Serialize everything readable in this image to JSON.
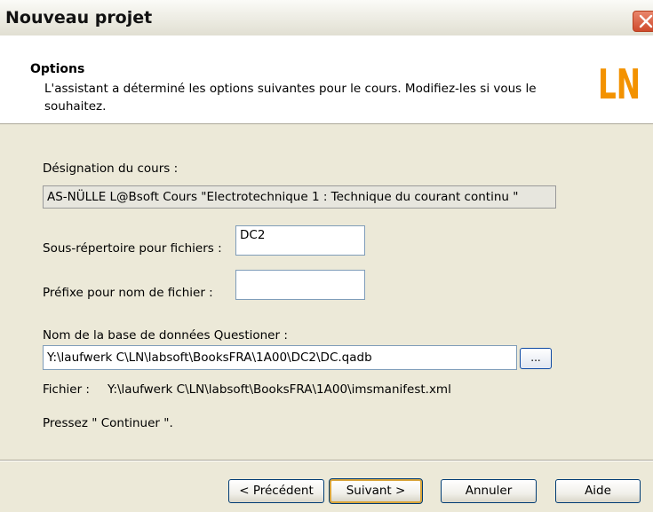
{
  "window": {
    "title": "Nouveau projet",
    "close_icon": "close-icon"
  },
  "header": {
    "title": "Options",
    "description": "L'assistant a déterminé les options suivantes pour le cours. Modifiez-les si vous le souhaitez.",
    "logo_text": "LN",
    "logo_color": "#f39200"
  },
  "form": {
    "course_label": "Désignation du cours :",
    "course_value": "AS-NÜLLE L@Bsoft Cours \"Electrotechnique 1 : Technique du courant continu \"",
    "subdir_label": "Sous-répertoire pour fichiers :",
    "subdir_value": "DC2",
    "prefix_label": "Préfixe pour nom de fichier :",
    "prefix_value": "",
    "db_label": "Nom de la base de données Questioner :",
    "db_value": "Y:\\laufwerk C\\LN\\labsoft\\BooksFRA\\1A00\\DC2\\DC.qadb",
    "browse_label": "...",
    "file_label": "Fichier :",
    "file_value": "Y:\\laufwerk C\\LN\\labsoft\\BooksFRA\\1A00\\imsmanifest.xml",
    "hint": "Pressez \" Continuer \"."
  },
  "buttons": {
    "previous": "< Précédent",
    "next": "Suivant >",
    "cancel": "Annuler",
    "help": "Aide"
  }
}
